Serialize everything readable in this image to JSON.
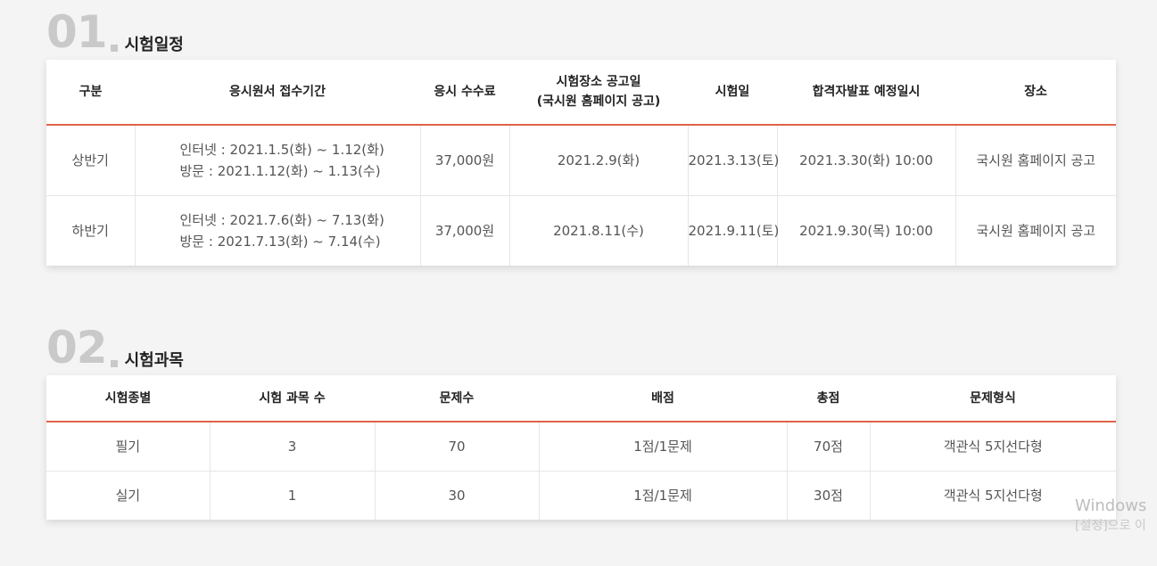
{
  "section1": {
    "number": "01",
    "title": "시험일정",
    "headers": [
      "구분",
      "응시원서 접수기간",
      "응시 수수료",
      "시험장소 공고일\n(국시원 홈페이지 공고)",
      "시험일",
      "합격자발표 예정일시",
      "장소"
    ],
    "rows": [
      {
        "category": "상반기",
        "period_line1": "인터넷 : 2021.1.5(화) ~ 1.12(화)",
        "period_line2": "방문 : 2021.1.12(화) ~ 1.13(수)",
        "fee": "37,000원",
        "venue_notice": "2021.2.9(화)",
        "exam_date": "2021.3.13(토)",
        "result_date": "2021.3.30(화) 10:00",
        "place": "국시원 홈페이지 공고"
      },
      {
        "category": "하반기",
        "period_line1": "인터넷 : 2021.7.6(화) ~ 7.13(화)",
        "period_line2": "방문 : 2021.7.13(화) ~ 7.14(수)",
        "fee": "37,000원",
        "venue_notice": "2021.8.11(수)",
        "exam_date": "2021.9.11(토)",
        "result_date": "2021.9.30(목) 10:00",
        "place": "국시원 홈페이지 공고"
      }
    ]
  },
  "section2": {
    "number": "02",
    "title": "시험과목",
    "headers": [
      "시험종별",
      "시험 과목 수",
      "문제수",
      "배점",
      "총점",
      "문제형식"
    ],
    "rows": [
      {
        "type": "필기",
        "subjects": "3",
        "questions": "70",
        "score": "1점/1문제",
        "total": "70점",
        "format": "객관식 5지선다형"
      },
      {
        "type": "실기",
        "subjects": "1",
        "questions": "30",
        "score": "1점/1문제",
        "total": "30점",
        "format": "객관식 5지선다형"
      }
    ]
  },
  "watermark": {
    "line1": "Windows",
    "line2": "[설정]으로 이"
  },
  "colors": {
    "accent": "#e0624a",
    "section_number": "#c9c9c9",
    "background": "#f4f4f4"
  }
}
